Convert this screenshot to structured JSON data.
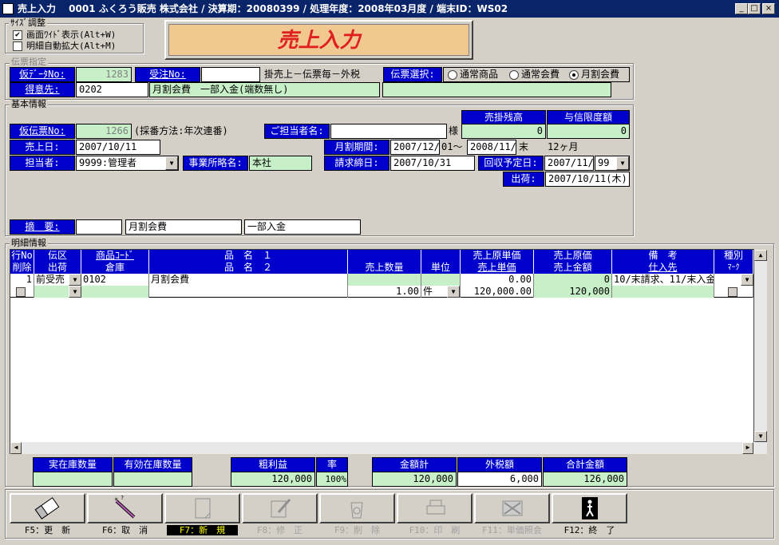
{
  "window": {
    "title": "売上入力　 0001 ふくろう販売 株式会社 / 決算期：20080399 / 処理年度：2008年03月度 / 端末ID：WS02",
    "min": "_",
    "max": "□",
    "close": "×"
  },
  "size_adjust": {
    "label": "ｻｲｽﾞ調整",
    "opt1": "画面ﾜｲﾄﾞ表示(Alt+W)",
    "opt1_checked": "✔",
    "opt2": "明細自動拡大(Alt+M)"
  },
  "banner": {
    "title": "売上入力",
    "bg": "#f0c890",
    "color": "#e02020"
  },
  "voucher": {
    "group_label": "伝票指定",
    "provisional_no_label": "仮ﾃﾞｰﾀNo:",
    "provisional_no": "1283",
    "order_no_label": "受注No:",
    "order_no": "",
    "sale_type": "掛売上－伝票毎－外税",
    "select_label": "伝票選択:",
    "radio1": "通常商品",
    "radio2": "通常会費",
    "radio3": "月割会費",
    "customer_label": "得意先:",
    "customer_code": "0202",
    "customer_name": "月割会費　一部入金(端数無し)",
    "customer_extra": ""
  },
  "basic": {
    "group_label": "基本情報",
    "receivable_label": "売掛残高",
    "credit_label": "与信限度額",
    "receivable": "0",
    "credit": "0",
    "provisional_no_label": "仮伝票No:",
    "provisional_no": "1266",
    "numbering": "(採番方法:年次連番)",
    "contact_label": "ご担当者名:",
    "contact": "",
    "contact_suffix": "様",
    "sales_date_label": "売上日:",
    "sales_date": "2007/10/11",
    "period_label": "月割期間:",
    "period_from": "2007/12/",
    "period_from_day": "01～",
    "period_to": "2008/11/",
    "period_to_day": "末",
    "months": "12ヶ月",
    "staff_label": "担当者:",
    "staff": "9999:管理者",
    "office_label": "事業所略名:",
    "office": "本社",
    "closing_label": "請求締日:",
    "closing": "2007/10/31",
    "collection_label": "回収予定日:",
    "collection": "2007/11/",
    "collection_day": "99",
    "shipping_label": "出荷:",
    "shipping": "2007/10/11(木)",
    "memo_label": "摘　要:",
    "memo1": "",
    "memo2": "月割会費",
    "memo3": "一部入金"
  },
  "detail": {
    "group_label": "明細情報",
    "headers_row1": [
      "行No",
      "伝区",
      "商品ｺｰﾄﾞ",
      "品　名　１",
      "",
      "",
      "売上原単価",
      "売上原価",
      "備　考",
      "種別"
    ],
    "headers_row2": [
      "削除",
      "出荷",
      "倉庫",
      "品　名　２",
      "売上数量",
      "単位",
      "売上単価",
      "売上金額",
      "仕入先",
      "ﾏｰｸ"
    ],
    "row1": {
      "line": "1",
      "kind": "前受売",
      "code": "0102",
      "name1": "月割会費",
      "cost_unit": "0.00",
      "cost": "0",
      "remarks": "10/末請求、11/末入金"
    },
    "row2": {
      "qty": "1.00",
      "unit": "件",
      "price": "120,000.00",
      "amount": "120,000"
    }
  },
  "summary": {
    "stock_label": "実在庫数量",
    "avail_label": "有効在庫数量",
    "stock": "",
    "avail": "",
    "gross_label": "粗利益",
    "rate_label": "率",
    "gross": "120,000",
    "rate": "100%",
    "total_label": "金額計",
    "tax_label": "外税額",
    "grand_label": "合計金額",
    "total": "120,000",
    "tax": "6,000",
    "grand": "126,000"
  },
  "fkeys": [
    {
      "label": "F5：更　新"
    },
    {
      "label": "F6：取　消"
    },
    {
      "label": "F7：新　規"
    },
    {
      "label": "F8：修　正"
    },
    {
      "label": "F9：削　除"
    },
    {
      "label": "F10：印　刷"
    },
    {
      "label": "F11：単価照会"
    },
    {
      "label": "F12：終　了"
    }
  ],
  "icons": [
    "eraser-icon",
    "magic-wand-icon",
    "new-document-icon",
    "edit-document-icon",
    "delete-recycle-icon",
    "printer-icon",
    "unit-price-icon",
    "exit-door-icon"
  ]
}
